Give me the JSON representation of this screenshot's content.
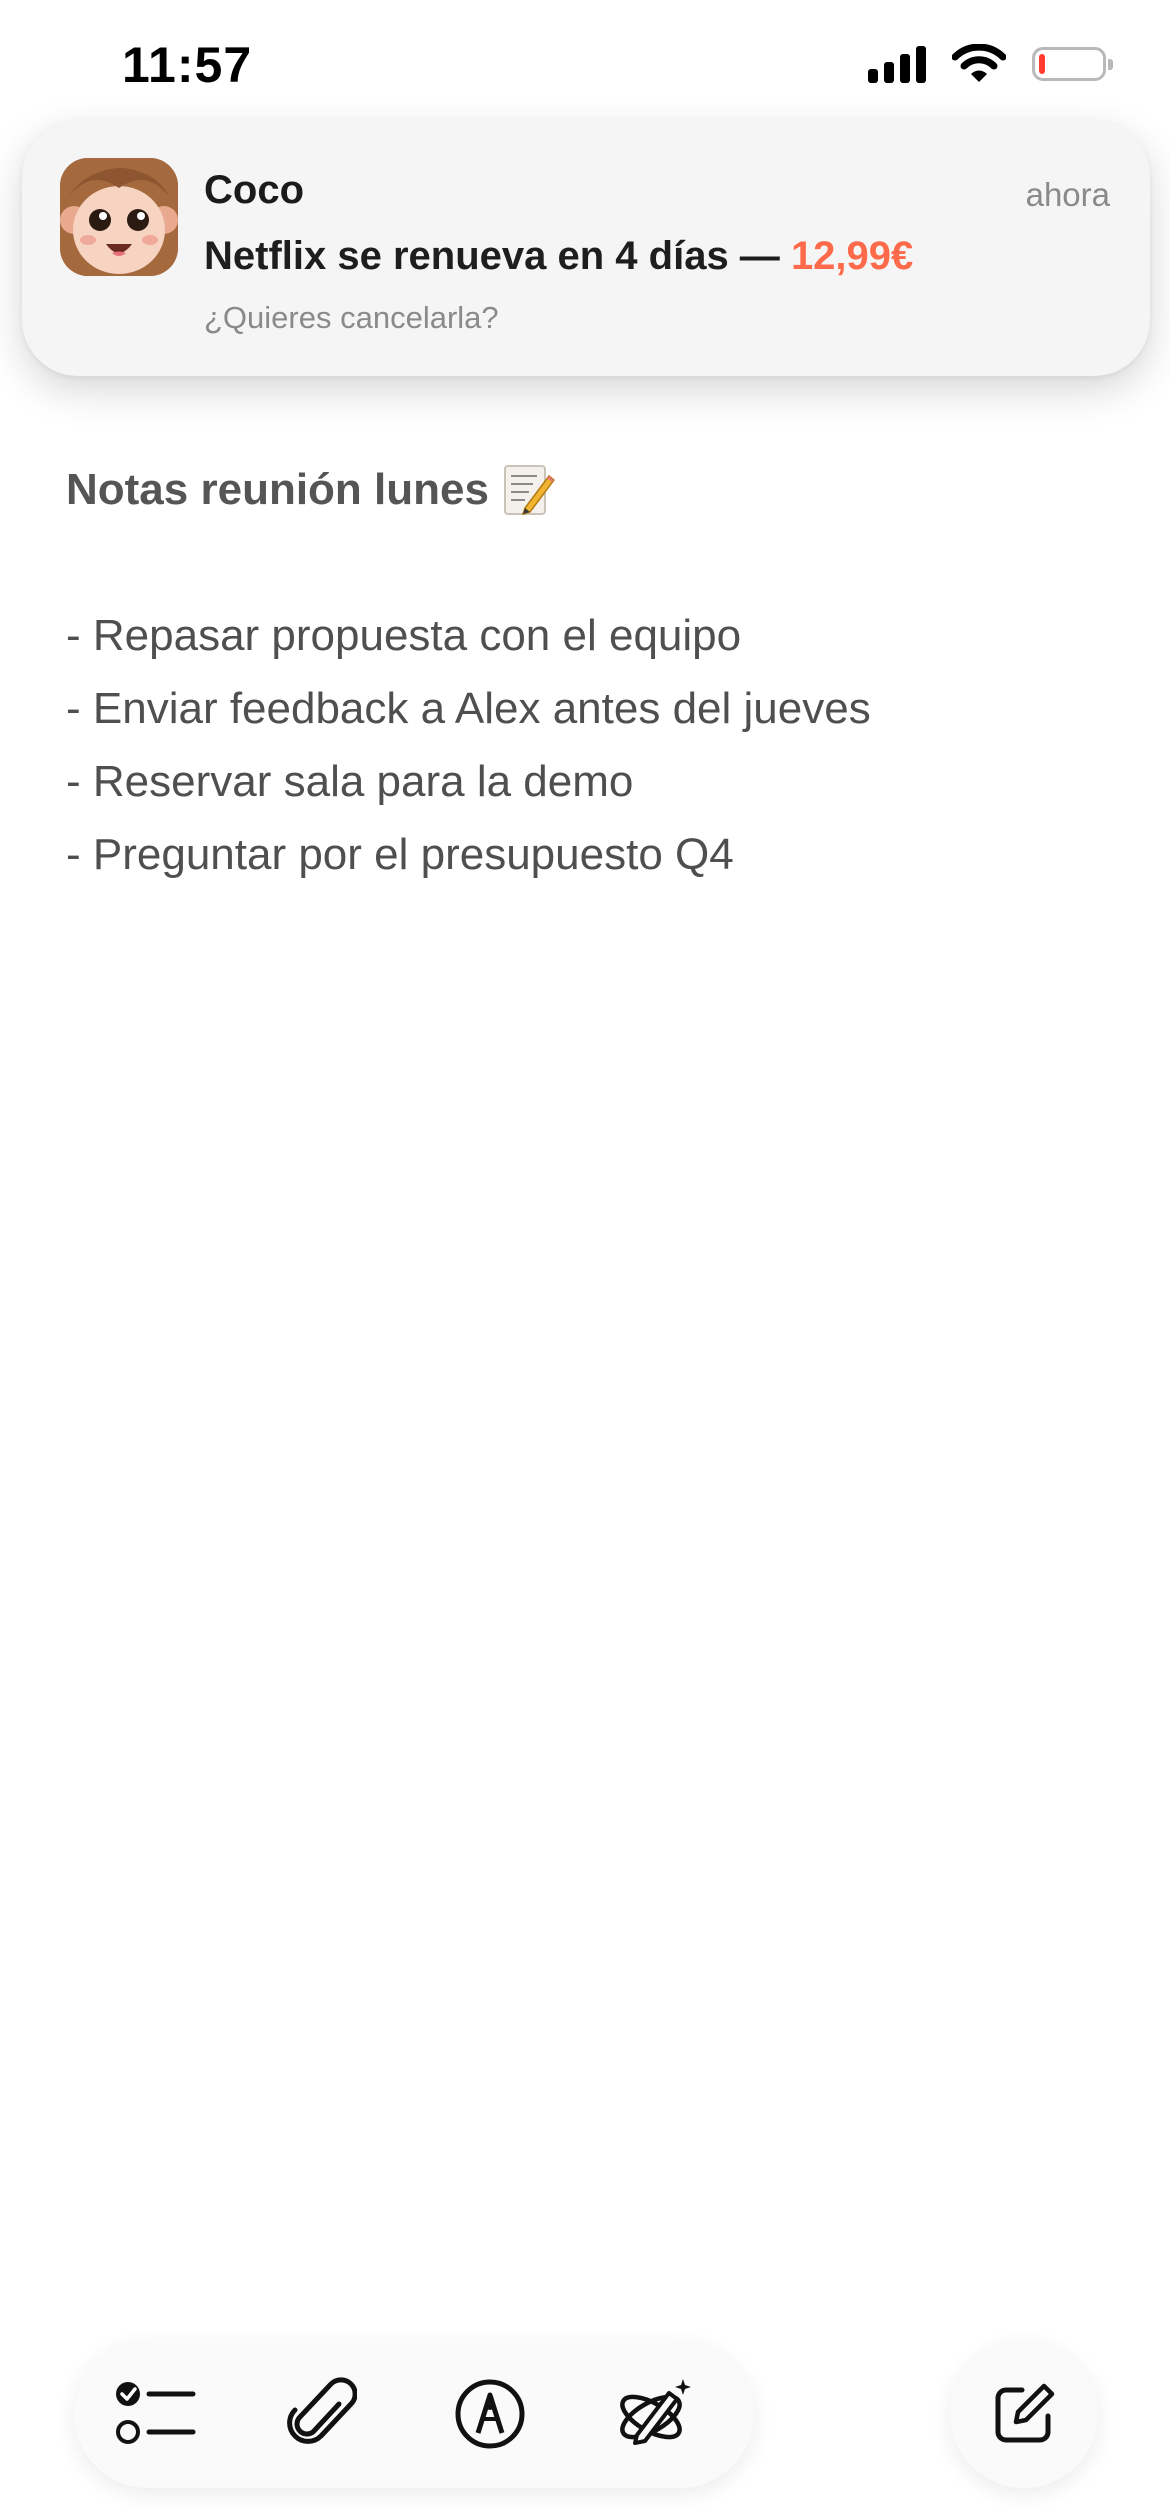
{
  "status_bar": {
    "time": "11:57",
    "icons": [
      "signal-icon",
      "wifi-icon",
      "battery-icon"
    ],
    "battery_level": 0.1,
    "battery_color": "#ff3b30"
  },
  "notification": {
    "app_name": "Coco",
    "time": "ahora",
    "message": "Netflix se renueva en 4 días —",
    "price": "12,99€",
    "subtitle": "¿Quieres cancelarla?",
    "price_color": "#ff6b4a",
    "icon": "coco-app-icon"
  },
  "note": {
    "title": "Notas reunión lunes",
    "title_icon": "memo-icon",
    "lines": [
      "- Repasar propuesta con el equipo",
      "- Enviar feedback a Alex antes del jueves",
      "- Reservar sala para la demo",
      "- Preguntar por el presupuesto Q4"
    ]
  },
  "toolbar": {
    "items": [
      {
        "icon": "checklist-icon"
      },
      {
        "icon": "paperclip-icon"
      },
      {
        "icon": "markup-pen-icon"
      },
      {
        "icon": "sparkle-pen-icon"
      }
    ],
    "compose_icon": "compose-icon"
  }
}
